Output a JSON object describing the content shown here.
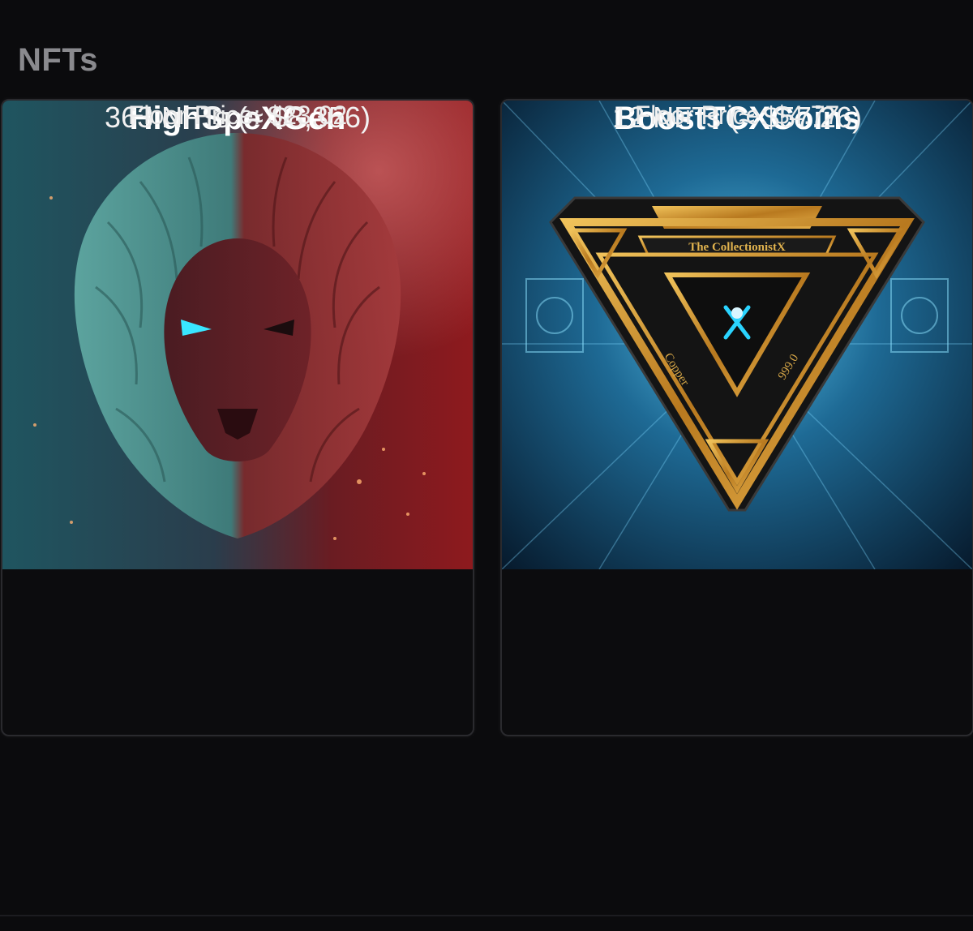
{
  "section": {
    "title": "NFTs"
  },
  "collections": [
    {
      "name": "HighSpeXGen",
      "count_text": "363 NFTs (≈ $8,356)",
      "floor_text": "Floor Price: $23.02",
      "image": "lion-head-artwork"
    },
    {
      "name": "BoostTCXCoins",
      "count_text": "12 NFTs (≈ $57.26)",
      "floor_text": "Floor Price: $4.77",
      "image": "the-collectionistx-copper-coin",
      "image_text": {
        "banner": "The CollectionistX",
        "left": "Copper",
        "right": "999.0"
      }
    }
  ],
  "colors": {
    "background": "#0b0b0d",
    "title": "#8a8a8e",
    "card_border": "#2a2a2e",
    "gold": "#c9962e",
    "cyan": "#2ad4ff"
  }
}
